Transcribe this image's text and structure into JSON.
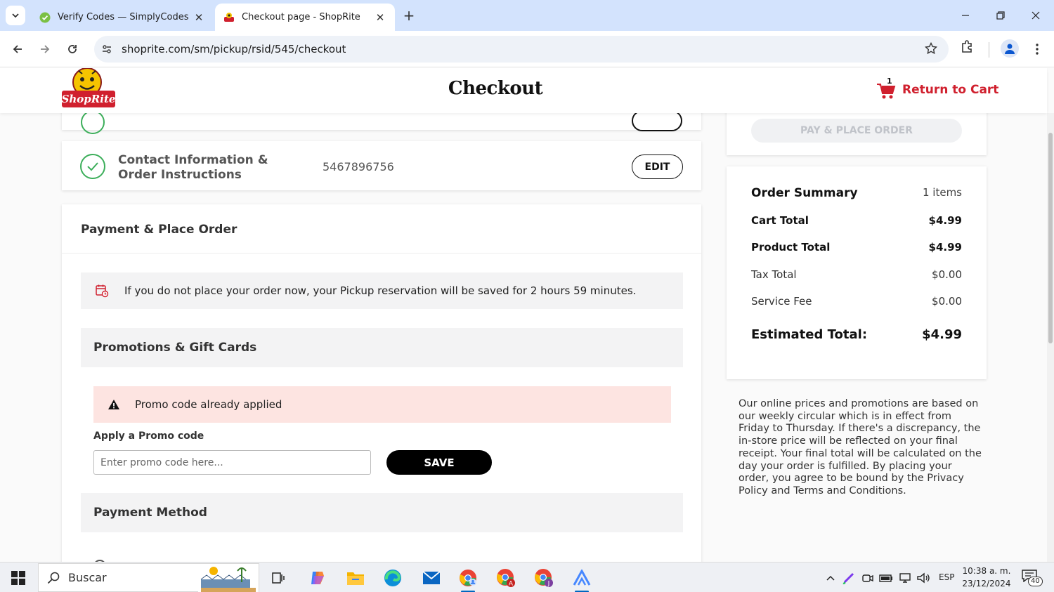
{
  "browser": {
    "tabs": [
      {
        "title": "Verify Codes — SimplyCodes",
        "active": false,
        "icon": "simplycodes-favicon"
      },
      {
        "title": "Checkout page - ShopRite",
        "active": true,
        "icon": "shoprite-favicon"
      }
    ],
    "url": "shoprite.com/sm/pickup/rsid/545/checkout"
  },
  "header": {
    "title": "Checkout",
    "return_to_cart": "Return to Cart",
    "cart_count": "1"
  },
  "contact": {
    "label": "Contact Information & Order Instructions",
    "value": "5467896756",
    "edit_label": "EDIT"
  },
  "payment": {
    "title": "Payment & Place Order",
    "notice": "If you do not place your order now, your Pickup reservation will be saved for 2 hours 59 minutes.",
    "promotions_title": "Promotions & Gift Cards",
    "promo_alert": "Promo code already applied",
    "apply_label": "Apply a Promo code",
    "promo_placeholder": "Enter promo code here...",
    "save_label": "SAVE",
    "payment_method_title": "Payment Method"
  },
  "summary": {
    "pay_button": "PAY & PLACE ORDER",
    "title": "Order Summary",
    "items": "1 items",
    "rows": [
      {
        "label": "Cart Total",
        "value": "$4.99"
      },
      {
        "label": "Product Total",
        "value": "$4.99"
      },
      {
        "label": "Tax Total",
        "value": "$0.00"
      },
      {
        "label": "Service Fee",
        "value": "$0.00"
      }
    ],
    "estimated_label": "Estimated Total:",
    "estimated_value": "$4.99",
    "disclaimer": "Our online prices and promotions are based on our weekly circular which is in effect from Friday to Thursday. If there's a discrepancy, the in-store price will be reflected on your final receipt. Your final total will be calculated on the day your order is fulfilled. By placing your order, you agree to be bound by the Privacy Policy and Terms and Conditions."
  },
  "taskbar": {
    "search_label": "Buscar",
    "language": "ESP",
    "time": "10:38 a. m.",
    "date": "23/12/2024",
    "notifications": "40"
  },
  "colors": {
    "brand_red": "#d0202e",
    "success_green": "#3cae5a",
    "alert_bg": "#fde4e1",
    "tabstrip": "#d3e3fd"
  }
}
